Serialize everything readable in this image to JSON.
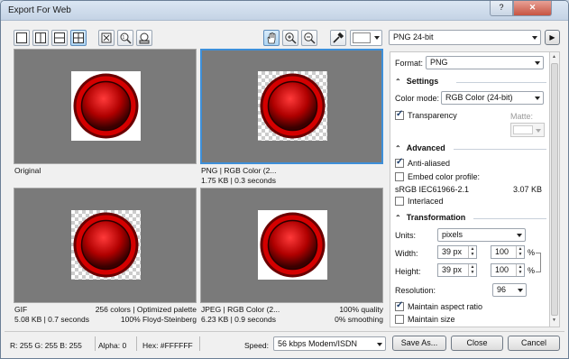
{
  "window": {
    "title": "Export For Web",
    "help_glyph": "?",
    "close_glyph": "✕"
  },
  "toolbar": {
    "view_buttons": [
      "single-view",
      "two-vertical-view",
      "two-horizontal-view",
      "four-view"
    ],
    "tool_buttons": [
      "fit-icon",
      "zoom-100-icon",
      "zoom-region-icon"
    ],
    "pan_zoom": [
      "hand-icon",
      "zoom-in-icon",
      "zoom-out-icon"
    ],
    "eyedropper": "eyedropper-icon",
    "preset": "PNG 24-bit",
    "next_glyph": "▶"
  },
  "previews": [
    {
      "caption_left": "Original",
      "caption_right": "",
      "line2_left": "",
      "line2_right": ""
    },
    {
      "caption_left": "PNG  |  RGB Color (2...",
      "caption_right": "",
      "line2_left": "1.75 KB  |  0.3 seconds",
      "line2_right": ""
    },
    {
      "caption_left": "GIF",
      "caption_right": "256 colors  |  Optimized palette",
      "line2_left": "5.08 KB  |  0.7 seconds",
      "line2_right": "100% Floyd-Steinberg"
    },
    {
      "caption_left": "JPEG  |  RGB Color (2...",
      "caption_right": "100% quality",
      "line2_left": "6.23 KB  |  0.9 seconds",
      "line2_right": "0% smoothing"
    }
  ],
  "panel": {
    "format_label": "Format:",
    "format_value": "PNG",
    "settings": {
      "title": "Settings",
      "color_mode_label": "Color mode:",
      "color_mode_value": "RGB Color (24-bit)",
      "transparency_label": "Transparency",
      "transparency_checked": true,
      "matte_label": "Matte:"
    },
    "advanced": {
      "title": "Advanced",
      "anti_aliased_label": "Anti-aliased",
      "anti_aliased_checked": true,
      "embed_profile_label": "Embed color profile:",
      "embed_profile_checked": false,
      "profile_name": "sRGB IEC61966-2.1",
      "profile_size": "3.07 KB",
      "interlaced_label": "Interlaced",
      "interlaced_checked": false
    },
    "transformation": {
      "title": "Transformation",
      "units_label": "Units:",
      "units_value": "pixels",
      "width_label": "Width:",
      "width_value": "39 px",
      "width_pct": "100",
      "height_label": "Height:",
      "height_value": "39 px",
      "height_pct": "100",
      "pct_symbol": "%",
      "resolution_label": "Resolution:",
      "resolution_value": "96",
      "maintain_aspect_label": "Maintain aspect ratio",
      "maintain_aspect_checked": true,
      "maintain_size_label": "Maintain size",
      "maintain_size_checked": false
    }
  },
  "status": {
    "rgb": "R: 255   G: 255   B: 255",
    "alpha": "Alpha: 0",
    "hex": "Hex: #FFFFFF",
    "speed_label": "Speed:",
    "speed_value": "56 kbps Modem/ISDN"
  },
  "buttons": {
    "save_as": "Save As...",
    "close": "Close",
    "cancel": "Cancel"
  },
  "colors": {
    "accent": "#3d8fd9",
    "preview_bg": "#7a7a7a",
    "button_red": "#c20000"
  }
}
